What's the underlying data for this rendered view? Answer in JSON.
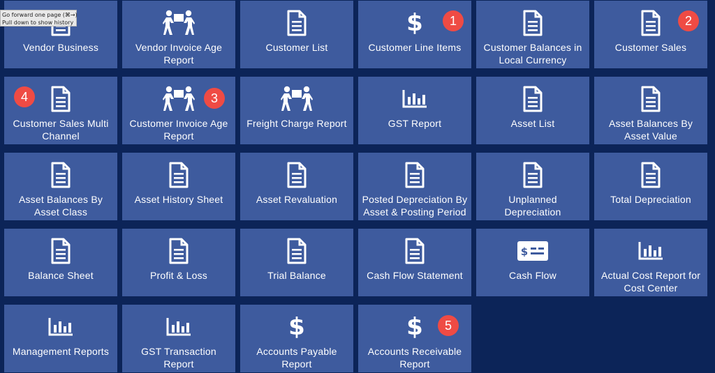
{
  "tooltip": {
    "line1": "Go forward one page (⌘→)",
    "line2": "Pull down to show history"
  },
  "tiles": [
    {
      "label_lines": [
        "Vendor Business"
      ],
      "icon": "document-icon",
      "name": "vendor-business"
    },
    {
      "label_lines": [
        "Vendor Invoice Age",
        "Report"
      ],
      "icon": "people-carry-icon",
      "name": "vendor-invoice-age-report"
    },
    {
      "label_lines": [
        "Customer List"
      ],
      "icon": "document-icon",
      "name": "customer-list"
    },
    {
      "label_lines": [
        "Customer Line Items"
      ],
      "icon": "dollar-icon",
      "name": "customer-line-items",
      "badge": "1"
    },
    {
      "label_lines": [
        "Customer Balances in",
        "Local Currency"
      ],
      "icon": "document-icon",
      "name": "customer-balances-local-currency"
    },
    {
      "label_lines": [
        "Customer Sales"
      ],
      "icon": "document-icon",
      "name": "customer-sales",
      "badge": "2"
    },
    {
      "label_lines": [
        "Customer Sales Multi",
        "Channel"
      ],
      "icon": "document-icon",
      "name": "customer-sales-multi-channel",
      "badge": "4"
    },
    {
      "label_lines": [
        "Customer Invoice Age",
        "Report"
      ],
      "icon": "people-carry-icon",
      "name": "customer-invoice-age-report",
      "badge": "3"
    },
    {
      "label_lines": [
        "Freight Charge Report"
      ],
      "icon": "people-carry-icon",
      "name": "freight-charge-report"
    },
    {
      "label_lines": [
        "GST Report"
      ],
      "icon": "bar-chart-icon",
      "name": "gst-report"
    },
    {
      "label_lines": [
        "Asset List"
      ],
      "icon": "document-icon",
      "name": "asset-list"
    },
    {
      "label_lines": [
        "Asset Balances By",
        "Asset Value"
      ],
      "icon": "document-icon",
      "name": "asset-balances-by-asset-value"
    },
    {
      "label_lines": [
        "Asset Balances By",
        "Asset Class"
      ],
      "icon": "document-icon",
      "name": "asset-balances-by-asset-class"
    },
    {
      "label_lines": [
        "Asset History Sheet"
      ],
      "icon": "document-icon",
      "name": "asset-history-sheet"
    },
    {
      "label_lines": [
        "Asset Revaluation"
      ],
      "icon": "document-icon",
      "name": "asset-revaluation"
    },
    {
      "label_lines": [
        "Posted Depreciation By",
        "Asset & Posting Period"
      ],
      "icon": "document-icon",
      "name": "posted-depreciation"
    },
    {
      "label_lines": [
        "Unplanned Depreciation"
      ],
      "icon": "document-icon",
      "name": "unplanned-depreciation"
    },
    {
      "label_lines": [
        "Total Depreciation"
      ],
      "icon": "document-icon",
      "name": "total-depreciation"
    },
    {
      "label_lines": [
        "Balance Sheet"
      ],
      "icon": "document-icon",
      "name": "balance-sheet"
    },
    {
      "label_lines": [
        "Profit & Loss"
      ],
      "icon": "document-icon",
      "name": "profit-and-loss"
    },
    {
      "label_lines": [
        "Trial Balance"
      ],
      "icon": "document-icon",
      "name": "trial-balance"
    },
    {
      "label_lines": [
        "Cash Flow Statement"
      ],
      "icon": "document-icon",
      "name": "cash-flow-statement"
    },
    {
      "label_lines": [
        "Cash Flow"
      ],
      "icon": "money-check-icon",
      "name": "cash-flow"
    },
    {
      "label_lines": [
        "Actual Cost Report for",
        "Cost Center"
      ],
      "icon": "bar-chart-icon",
      "name": "actual-cost-report-cost-center"
    },
    {
      "label_lines": [
        "Management Reports"
      ],
      "icon": "bar-chart-icon",
      "name": "management-reports"
    },
    {
      "label_lines": [
        "GST Transaction Report"
      ],
      "icon": "bar-chart-icon",
      "name": "gst-transaction-report"
    },
    {
      "label_lines": [
        "Accounts Payable",
        "Report"
      ],
      "icon": "dollar-icon",
      "name": "accounts-payable-report"
    },
    {
      "label_lines": [
        "Accounts Receivable",
        "Report"
      ],
      "icon": "dollar-icon",
      "name": "accounts-receivable-report",
      "badge": "5"
    }
  ],
  "colors": {
    "background": "#0c2458",
    "tile": "#3e5b9e",
    "badge": "#ef4b44",
    "text": "#ffffff"
  }
}
